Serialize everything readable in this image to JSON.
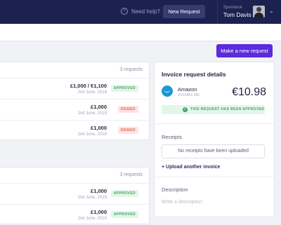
{
  "topbar": {
    "help_icon": "question-circle-icon",
    "help_icon_glyph": "?",
    "help_label": "Need help?",
    "new_request_label": "New Request",
    "company": "Spendesk",
    "user_name": "Tom Davis",
    "chevron_glyph": "⌄"
  },
  "actions": {
    "make_request_label": "Make a new request"
  },
  "groups": [
    {
      "count_label": "3 requests",
      "rows": [
        {
          "amount": "£1,000 / €1,100",
          "date": "2nd June, 2019",
          "status": "APPROVED"
        },
        {
          "amount": "£1,000",
          "date": "2nd June, 2019",
          "status": "DENIED"
        },
        {
          "amount": "£1,000",
          "date": "2nd June, 2019",
          "status": "DENIED"
        }
      ]
    },
    {
      "count_label": "3 requests",
      "rows": [
        {
          "amount": "£1,000",
          "date": "2nd June, 2019",
          "status": "APPROVED"
        },
        {
          "amount": "£1,000",
          "date": "2nd June, 2019",
          "status": "APPROVED"
        }
      ]
    }
  ],
  "details": {
    "title": "Invoice request details",
    "vendor_icon": "amazon-logo-icon",
    "vendor": "Amazon",
    "reference": "#123451 RD",
    "amount": "€10.98",
    "status_icon": "check-circle-icon",
    "status_glyph": "✓",
    "status_message": "THIS REQUEST HAS BEEN APPROVED",
    "receipts_label": "Receipts",
    "receipts_empty": "No receipts have been uploaded",
    "upload_label": "+ Upload another invoice",
    "description_label": "Description",
    "description_placeholder": "Write a description",
    "description_value": ""
  },
  "colors": {
    "topbar": "#1b2250",
    "accent": "#5b2bdc",
    "approved_bg": "#e3f6e8",
    "approved_text": "#3fa463",
    "denied_bg": "#fde4df",
    "denied_text": "#e06b55",
    "vendor_logo": "#1a98d5"
  }
}
